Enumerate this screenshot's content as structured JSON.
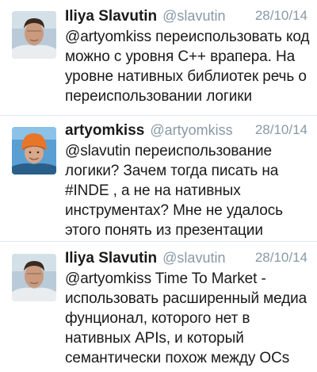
{
  "tweets": [
    {
      "author_name": "Iliya Slavutin",
      "screen_name": "@slavutin",
      "date": "28/10/14",
      "avatar": "avatar-photo-man",
      "text_lines": [
        "@artyomkiss переиспользовать код",
        "можно с уровня C++ врапера. На",
        "уровне нативных библиотек речь о",
        "переиспользовании логики"
      ]
    },
    {
      "author_name": "artyomkiss",
      "screen_name": "@artyomkiss",
      "date": "28/10/14",
      "avatar": "avatar-photo-helmet",
      "text_lines": [
        "@slavutin переиспользование",
        "логики? Зачем тогда писать на",
        "#INDE , а не на нативных",
        "инструментах? Мне не удалось",
        "этого понять из презентации"
      ]
    },
    {
      "author_name": "Iliya Slavutin",
      "screen_name": "@slavutin",
      "date": "28/10/14",
      "avatar": "avatar-photo-man",
      "text_lines": [
        "@artyomkiss Time To Market -",
        "использовать расширенный медиа",
        "фунционал, которого нет в",
        "нативных APIs, и который",
        "семантически похож между OCs"
      ]
    }
  ],
  "colors": {
    "text": "#1a1a1a",
    "secondary": "#8899a6",
    "separator": "#e1e8ed"
  }
}
